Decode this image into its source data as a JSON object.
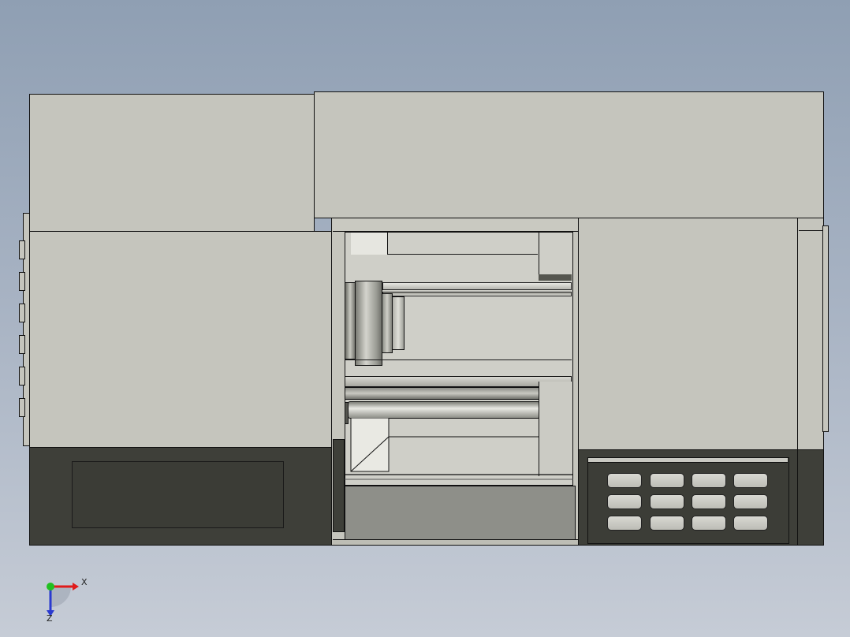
{
  "view": {
    "background_top": "#8f9fb3",
    "background_bottom": "#c6ccd6",
    "body_color": "#c5c5bd",
    "dark_color": "#3e3f39"
  },
  "triad": {
    "x_label": "X",
    "z_label": "Z",
    "x_color": "#e01b1b",
    "y_color": "#20c020",
    "z_color": "#2a3ad0"
  },
  "keypad": {
    "rows": 3,
    "cols": 4
  }
}
